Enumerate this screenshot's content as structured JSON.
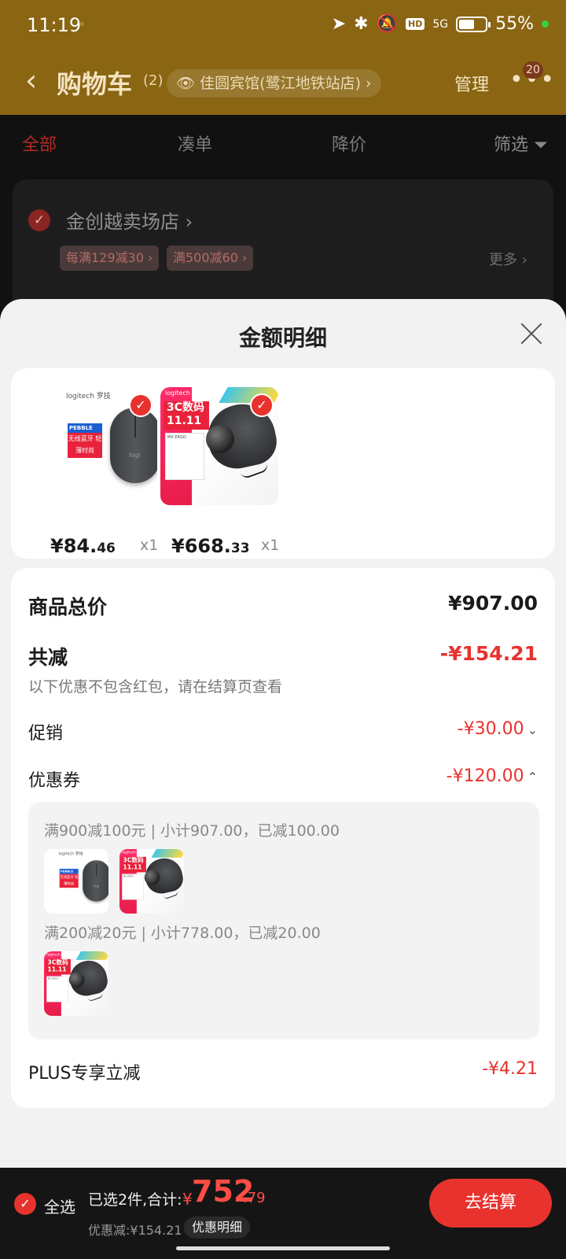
{
  "status_bar": {
    "time": "11:19",
    "tiny": "⁰",
    "hd": "HD",
    "network": "5G",
    "battery": "55%"
  },
  "header": {
    "back": "‹",
    "title": "购物车",
    "count": "(2)",
    "location": "佳圆宾馆(鹭江地铁站店) ›",
    "manage": "管理",
    "more": "•••",
    "badge": "20"
  },
  "tabs": [
    {
      "label": "全部",
      "active": true
    },
    {
      "label": "凑单"
    },
    {
      "label": "降价"
    }
  ],
  "filter_label": "筛选 ⏷",
  "store": {
    "name": "金创越卖场店 ›",
    "promos": [
      "每满129减30 ›",
      "满500减60 ›"
    ],
    "more": "更多 ›"
  },
  "sheet": {
    "title": "金额明细",
    "products": [
      {
        "price_int": "¥84.",
        "price_dec": "46",
        "qty": "x1",
        "logo": "logitech 罗技",
        "tag": "PEBBLE",
        "red_text": "无线蓝牙 轻薄时尚",
        "mouse_text": "logi"
      },
      {
        "price_int": "¥668.",
        "price_dec": "33",
        "qty": "x1",
        "logo": "logitech 罗技",
        "promo_text": "3C数码 11.11",
        "box_text": "MX ERGO"
      }
    ],
    "total_label": "商品总价",
    "total_value": "¥907.00",
    "reduce_label": "共减",
    "reduce_value": "-¥154.21",
    "note": "以下优惠不包含红包，请在结算页查看",
    "promo_label": "促销",
    "promo_value": "-¥30.00",
    "coupon_label": "优惠券",
    "coupon_value": "-¥120.00",
    "coupon_rules": [
      "满900减100元 | 小计907.00，已减100.00",
      "满200减20元 | 小计778.00，已减20.00"
    ],
    "plus_label": "PLUS专享立减",
    "plus_value": "-¥4.21"
  },
  "bottom": {
    "select_all": "全选",
    "summary": "已选2件,合计:",
    "yen": "¥",
    "total_int": "752",
    "total_dec": ".79",
    "discount": "优惠减:¥154.21",
    "detail_button": "优惠明细",
    "checkout": "去结算"
  },
  "colors": {
    "accent": "#e8322e",
    "header_bg": "#8a6512"
  }
}
